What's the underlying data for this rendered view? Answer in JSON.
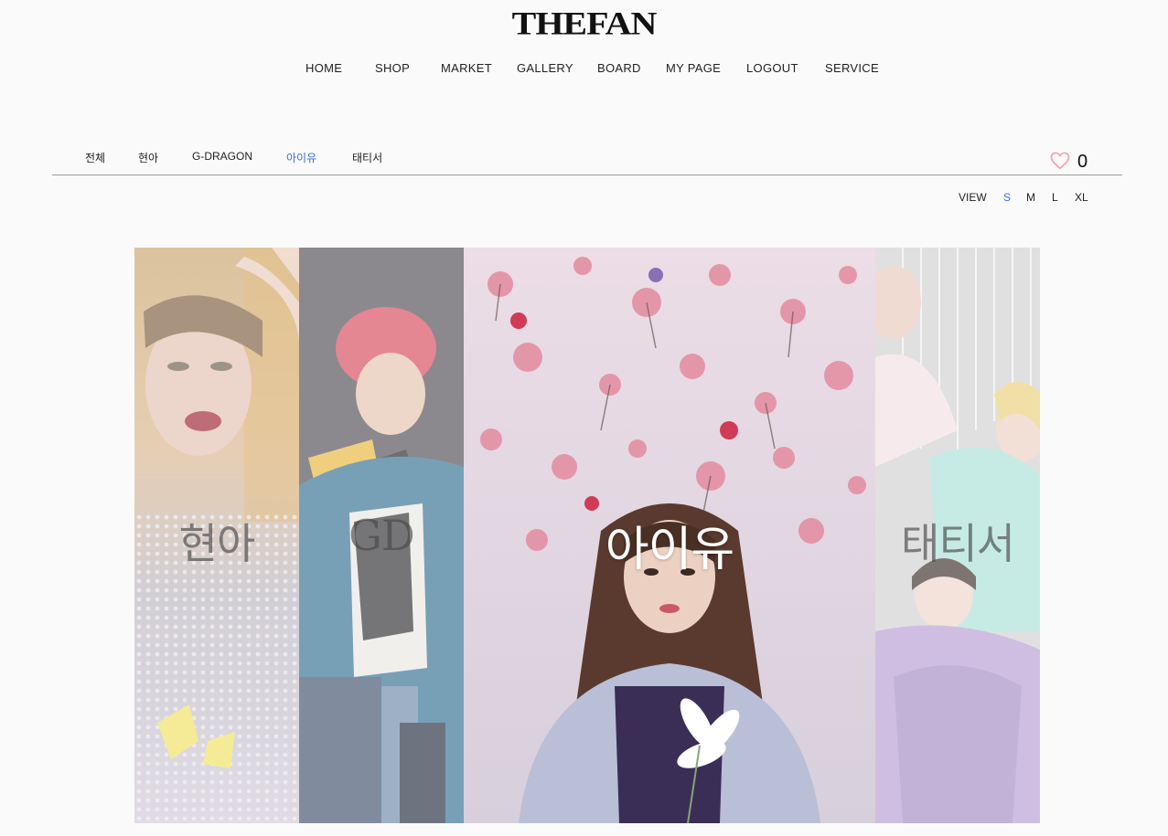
{
  "brand": {
    "logo": "THEFAN"
  },
  "nav": [
    {
      "label": "HOME"
    },
    {
      "label": "SHOP"
    },
    {
      "label": "MARKET"
    },
    {
      "label": "GALLERY"
    },
    {
      "label": "BOARD"
    },
    {
      "label": "MY PAGE"
    },
    {
      "label": "LOGOUT"
    },
    {
      "label": "SERVICE"
    }
  ],
  "filters": {
    "items": [
      {
        "label": "전체"
      },
      {
        "label": "현아"
      },
      {
        "label": "G-DRAGON"
      },
      {
        "label": "아이유"
      },
      {
        "label": "태티서"
      }
    ],
    "active": "아이유"
  },
  "likes": {
    "icon": "heart-icon",
    "count": "0",
    "color": "#f4a6b6"
  },
  "view": {
    "label": "VIEW",
    "options": [
      "S",
      "M",
      "L",
      "XL"
    ],
    "selected": "S"
  },
  "gallery": {
    "panels": [
      {
        "caption": "현아",
        "artist": "HyunA"
      },
      {
        "caption": "GD",
        "artist": "G-DRAGON"
      },
      {
        "caption": "아이유",
        "artist": "IU"
      },
      {
        "caption": "태티서",
        "artist": "TaeTiSeo"
      }
    ]
  },
  "colors": {
    "accent": "#3a6fd8",
    "background": "#fafafa"
  }
}
